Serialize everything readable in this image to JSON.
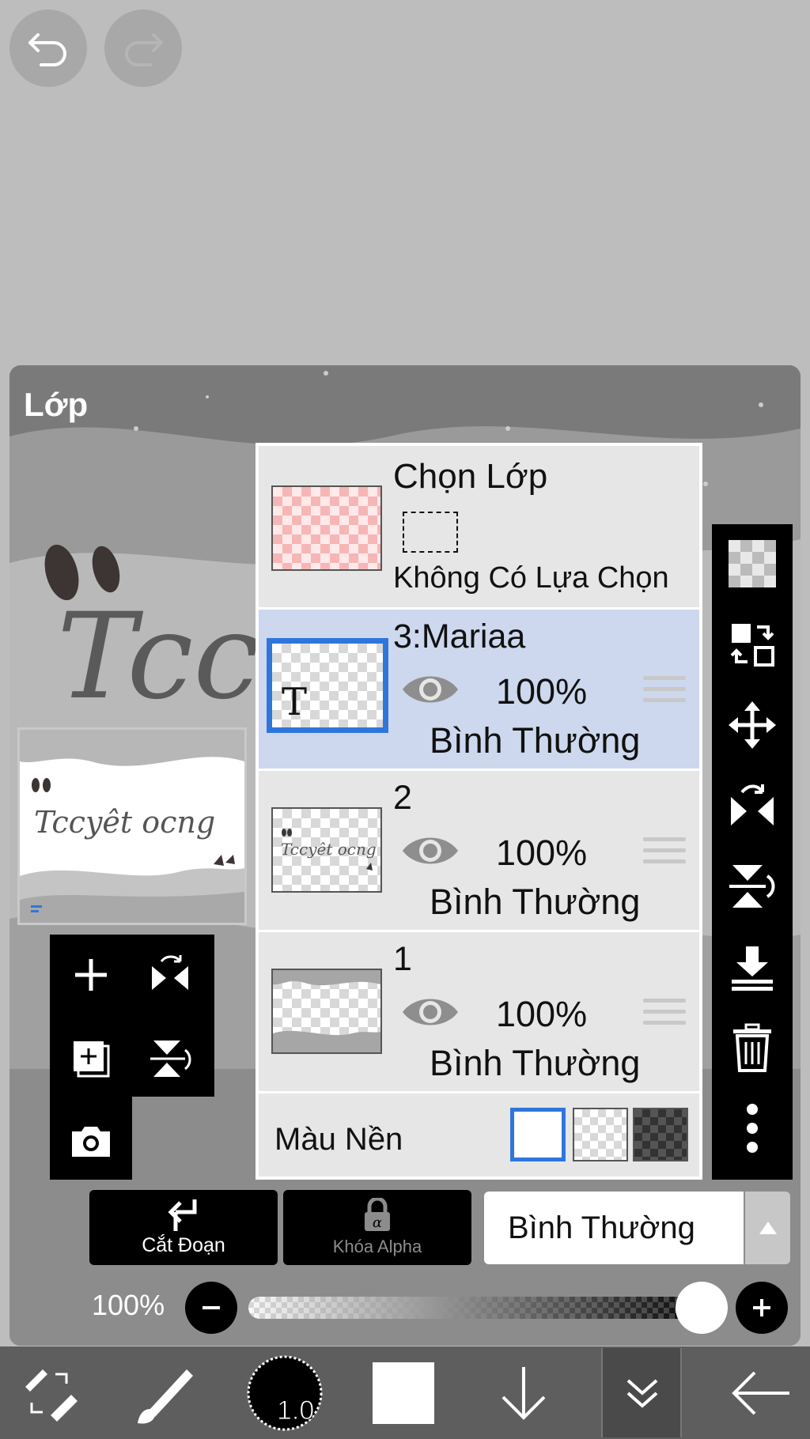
{
  "top_controls": {
    "undo_icon": "undo-icon",
    "redo_icon": "redo-icon"
  },
  "panel": {
    "title": "Lớp"
  },
  "layer_panel": {
    "selection_layer": {
      "title": "Chọn Lớp",
      "status": "Không Có Lựa Chọn"
    },
    "layers": [
      {
        "name": "3:Mariaa",
        "opacity": "100%",
        "blend_mode": "Bình Thường",
        "type_icon": "T",
        "selected": true
      },
      {
        "name": "2",
        "opacity": "100%",
        "blend_mode": "Bình Thường",
        "selected": false
      },
      {
        "name": "1",
        "opacity": "100%",
        "blend_mode": "Bình Thường",
        "selected": false
      }
    ],
    "background": {
      "label": "Màu Nền",
      "options": [
        "white",
        "transparent",
        "dark-checker"
      ],
      "selected": "white"
    }
  },
  "layer_actions": {
    "clipping_label": "Cắt Đoạn",
    "alpha_lock_label": "Khóa Alpha",
    "blend_mode_value": "Bình Thường"
  },
  "opacity_slider": {
    "label": "100%",
    "value": 1.0
  },
  "bottom_toolbar": {
    "brush_size": "1.0",
    "active_tool": "layers"
  },
  "colors": {
    "accent": "#2f76db",
    "selected_row": "#cdd8ee",
    "toolbar": "#000000",
    "bottom_bar": "#5e5e5e"
  }
}
